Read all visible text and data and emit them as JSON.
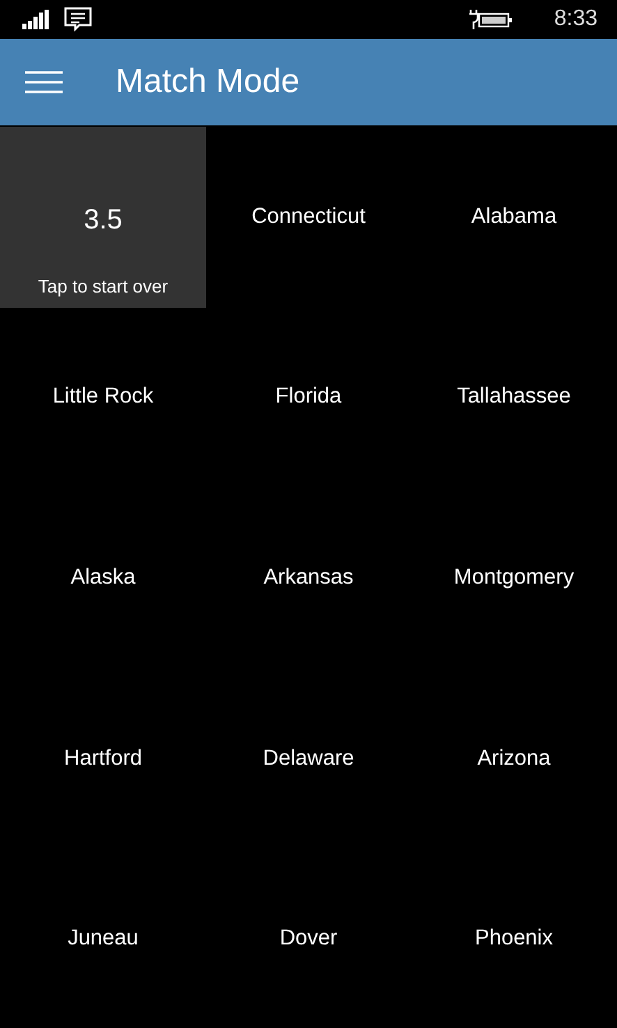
{
  "status_bar": {
    "time": "8:33"
  },
  "header": {
    "title": "Match Mode"
  },
  "grid": {
    "cells": [
      {
        "kind": "timer",
        "value": "3.5",
        "caption": "Tap to start over"
      },
      {
        "kind": "word",
        "label": "Connecticut"
      },
      {
        "kind": "word",
        "label": "Alabama"
      },
      {
        "kind": "word",
        "label": "Little Rock"
      },
      {
        "kind": "word",
        "label": "Florida"
      },
      {
        "kind": "word",
        "label": "Tallahassee"
      },
      {
        "kind": "word",
        "label": "Alaska"
      },
      {
        "kind": "word",
        "label": "Arkansas"
      },
      {
        "kind": "word",
        "label": "Montgomery"
      },
      {
        "kind": "word",
        "label": "Hartford"
      },
      {
        "kind": "word",
        "label": "Delaware"
      },
      {
        "kind": "word",
        "label": "Arizona"
      },
      {
        "kind": "word",
        "label": "Juneau"
      },
      {
        "kind": "word",
        "label": "Dover"
      },
      {
        "kind": "word",
        "label": "Phoenix"
      }
    ]
  }
}
